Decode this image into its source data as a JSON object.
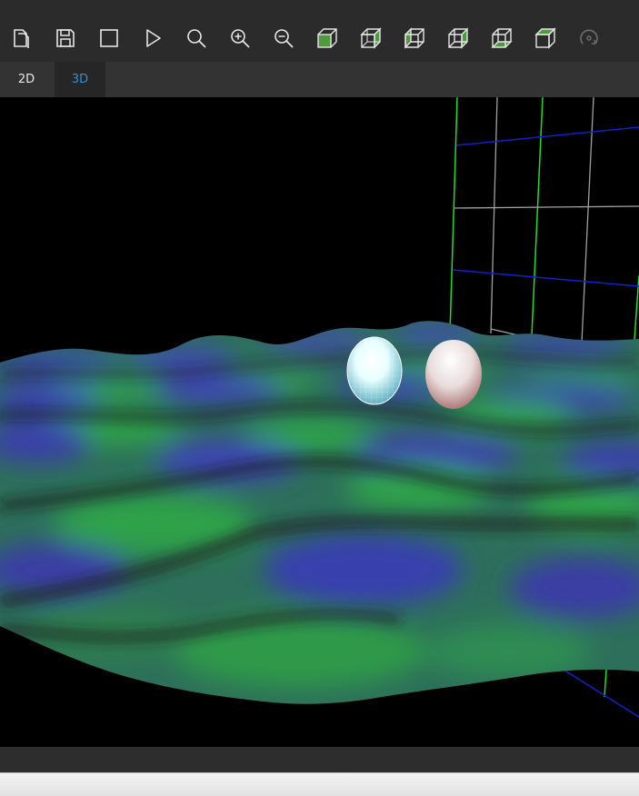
{
  "toolbar": {
    "items": [
      {
        "name": "new-document-icon",
        "tooltip": ""
      },
      {
        "name": "save-icon",
        "tooltip": ""
      },
      {
        "name": "stop-icon",
        "tooltip": ""
      },
      {
        "name": "play-icon",
        "tooltip": ""
      },
      {
        "name": "search-icon",
        "tooltip": ""
      },
      {
        "name": "zoom-in-icon",
        "tooltip": ""
      },
      {
        "name": "zoom-out-icon",
        "tooltip": ""
      },
      {
        "name": "cube-view-front-icon",
        "tooltip": ""
      },
      {
        "name": "cube-view-top-icon",
        "tooltip": ""
      },
      {
        "name": "cube-view-left-icon",
        "tooltip": ""
      },
      {
        "name": "cube-view-right-icon",
        "tooltip": ""
      },
      {
        "name": "cube-view-bottom-icon",
        "tooltip": ""
      },
      {
        "name": "cube-view-iso-icon",
        "tooltip": ""
      },
      {
        "name": "rotate-icon",
        "tooltip": ""
      }
    ]
  },
  "tabs": [
    {
      "label": "2D",
      "active": false
    },
    {
      "label": "3D",
      "active": true
    }
  ],
  "colors": {
    "accent": "#2f8fe0",
    "surface_green": "#2f9a45",
    "surface_blue": "#3a3fa8",
    "grid_green": "#22dd22",
    "grid_blue": "#1020d0",
    "grid_gray": "#9a9a9a"
  }
}
